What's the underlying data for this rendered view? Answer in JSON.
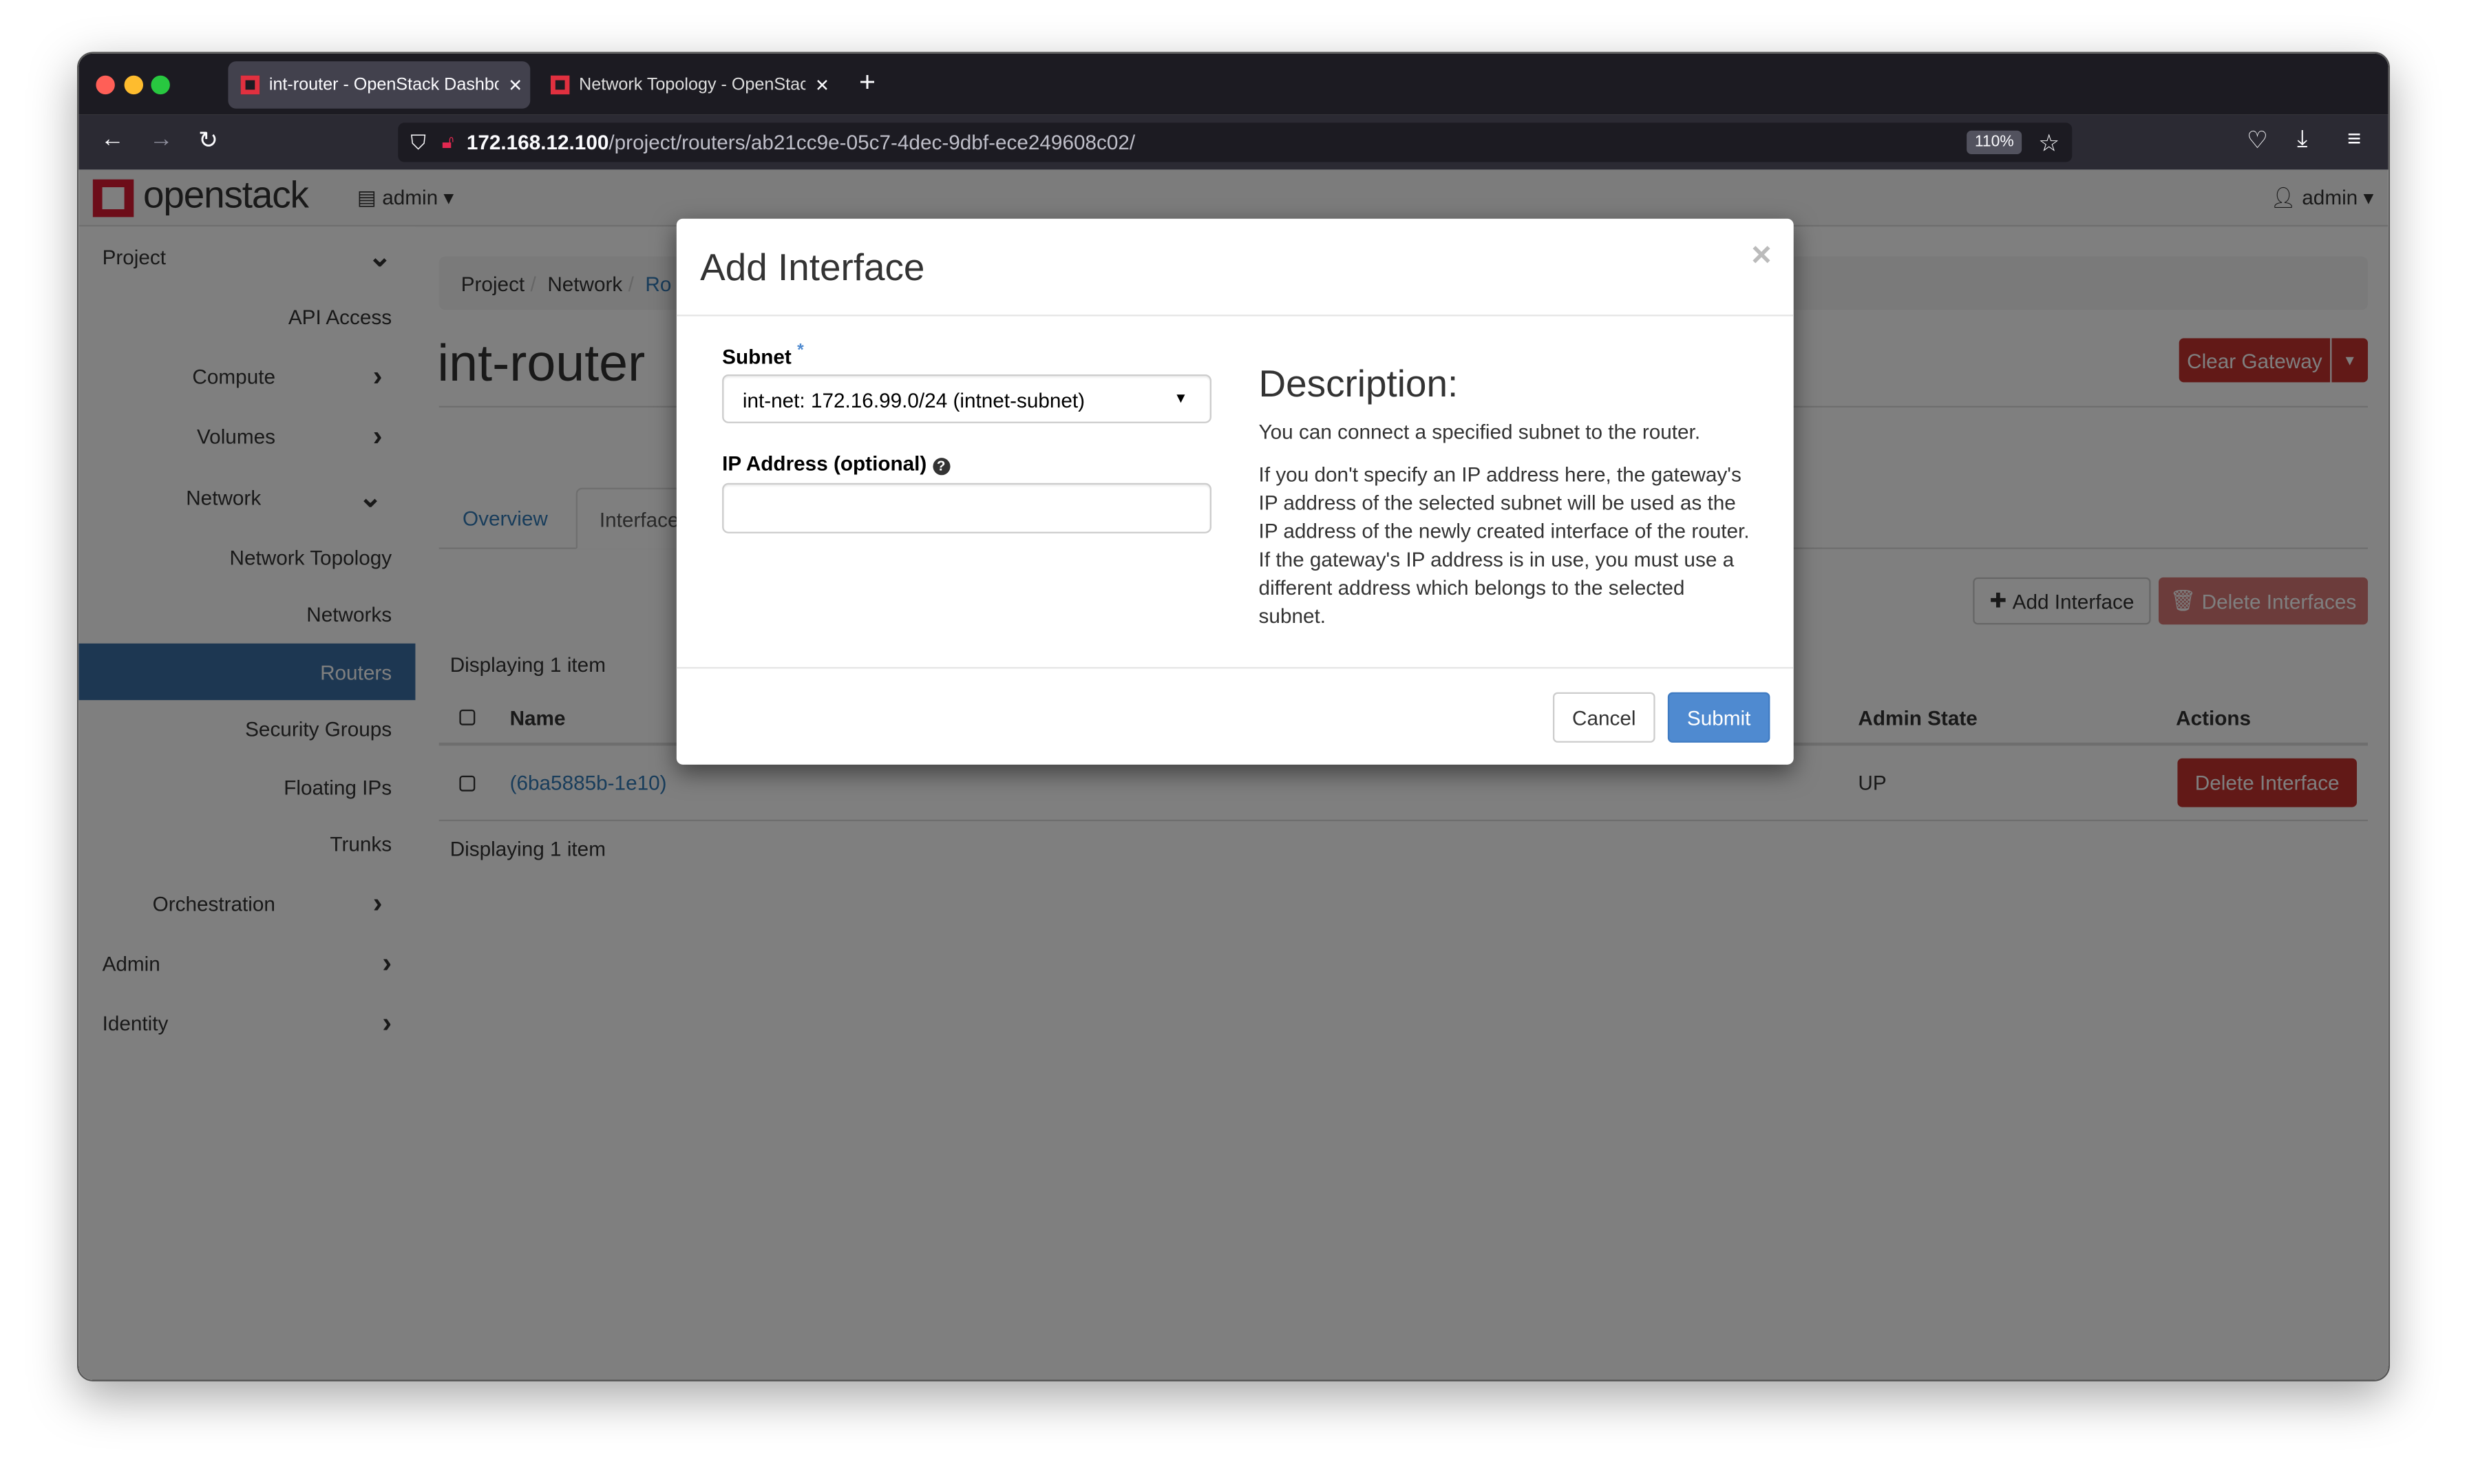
{
  "browser": {
    "tabs": [
      {
        "title": "int-router - OpenStack Dashboa",
        "active": true
      },
      {
        "title": "Network Topology - OpenStack",
        "active": false
      }
    ],
    "url_host": "172.168.12.100",
    "url_path": "/project/routers/ab21cc9e-05c7-4dec-9dbf-ece249608c02/",
    "zoom": "110%"
  },
  "header": {
    "logo": "openstack",
    "project_menu": "admin",
    "user_menu": "admin"
  },
  "sidebar": {
    "items": [
      {
        "label": "Project",
        "level": "top",
        "chev": "⌄"
      },
      {
        "label": "API Access",
        "level": "leaf"
      },
      {
        "label": "Compute",
        "level": "mid",
        "chev": "›"
      },
      {
        "label": "Volumes",
        "level": "mid",
        "chev": "›"
      },
      {
        "label": "Network",
        "level": "mid",
        "chev": "⌄"
      },
      {
        "label": "Network Topology",
        "level": "leaf"
      },
      {
        "label": "Networks",
        "level": "leaf"
      },
      {
        "label": "Routers",
        "level": "leaf",
        "active": true
      },
      {
        "label": "Security Groups",
        "level": "leaf"
      },
      {
        "label": "Floating IPs",
        "level": "leaf"
      },
      {
        "label": "Trunks",
        "level": "leaf"
      },
      {
        "label": "Orchestration",
        "level": "mid",
        "chev": "›"
      },
      {
        "label": "Admin",
        "level": "top",
        "chev": "›"
      },
      {
        "label": "Identity",
        "level": "top",
        "chev": "›"
      }
    ]
  },
  "main": {
    "breadcrumb": [
      "Project",
      "Network",
      "Ro"
    ],
    "title": "int-router",
    "clear_gateway": "Clear Gateway",
    "tabs": [
      "Overview",
      "Interface"
    ],
    "add_interface": "Add Interface",
    "delete_interfaces": "Delete Interfaces",
    "displaying": "Displaying 1 item",
    "columns": {
      "name": "Name",
      "admin_state": "Admin State",
      "actions": "Actions"
    },
    "rows": [
      {
        "name": "(6ba5885b-1e10)",
        "admin_state": "UP",
        "action": "Delete Interface"
      }
    ]
  },
  "modal": {
    "title": "Add Interface",
    "close": "×",
    "subnet_label": "Subnet",
    "required_mark": "*",
    "subnet_value": "int-net: 172.16.99.0/24 (intnet-subnet)",
    "ip_label": "IP Address (optional)",
    "ip_value": "",
    "desc_title": "Description:",
    "desc_p1": "You can connect a specified subnet to the router.",
    "desc_p2": "If you don't specify an IP address here, the gateway's IP address of the selected subnet will be used as the IP address of the newly created interface of the router. If the gateway's IP address is in use, you must use a different address which belongs to the selected subnet.",
    "cancel": "Cancel",
    "submit": "Submit"
  },
  "colors": {
    "accent": "#4f8ad0",
    "danger": "#c4332f",
    "active_nav": "#3a6ea5"
  }
}
